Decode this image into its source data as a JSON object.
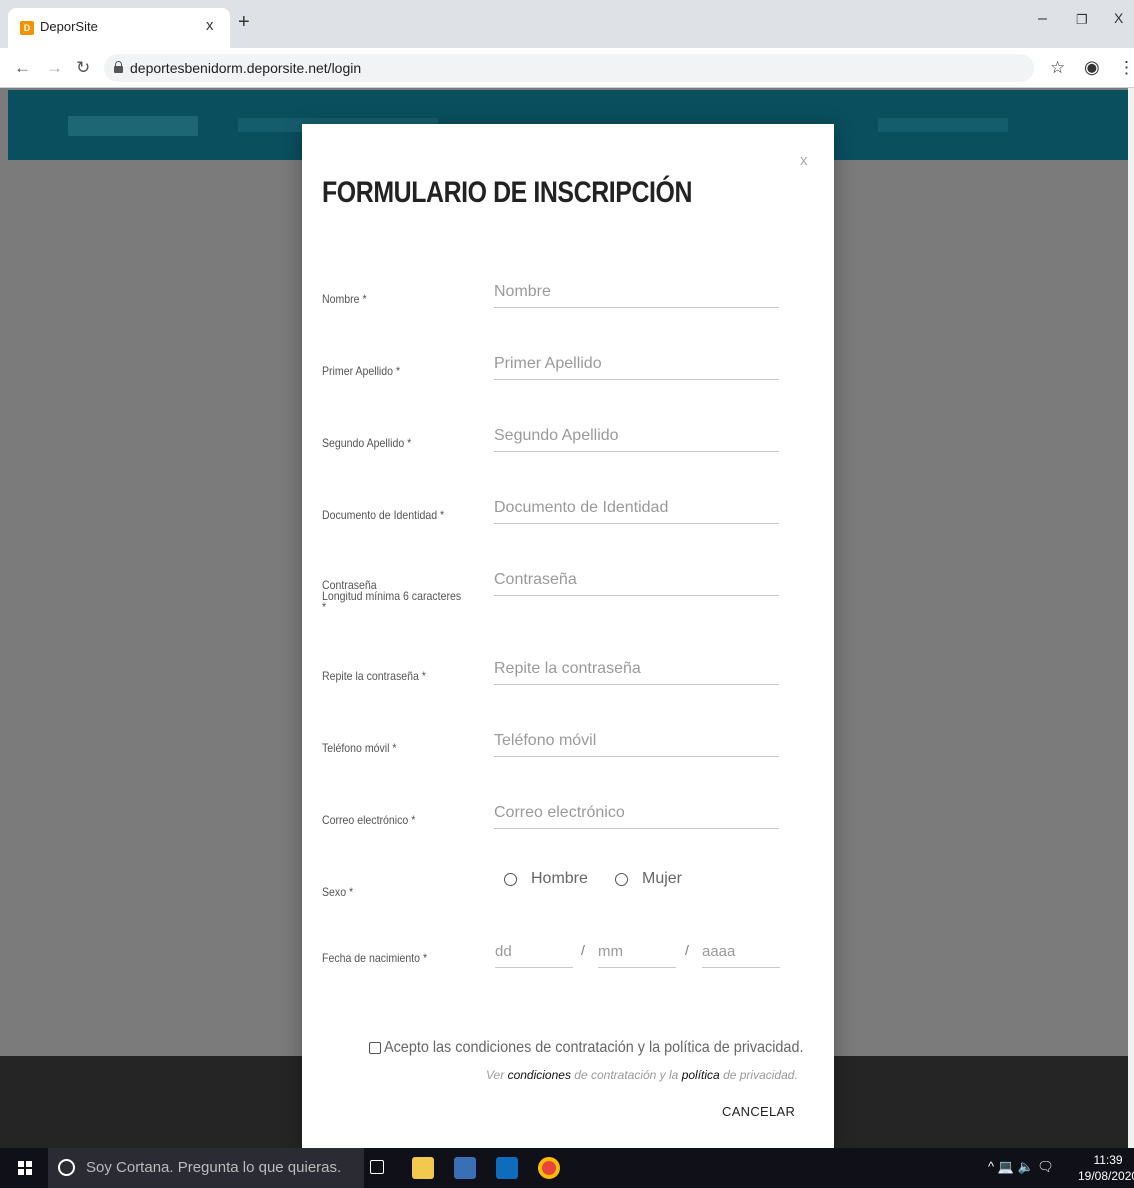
{
  "browser": {
    "tab_title": "DeporSite",
    "tab_favicon": "D",
    "tab_close": "x",
    "new_tab": "+",
    "url": "deportesbenidorm.deporsite.net/login",
    "window_controls": {
      "minimize": "–",
      "restore": "❐",
      "close": "X"
    }
  },
  "modal": {
    "close": "x",
    "title": "FORMULARIO DE INSCRIPCIÓN",
    "fields": {
      "nombre": {
        "label": "Nombre *",
        "placeholder": "Nombre"
      },
      "primer_apellido": {
        "label": "Primer Apellido *",
        "placeholder": "Primer Apellido"
      },
      "segundo_apellido": {
        "label": "Segundo Apellido *",
        "placeholder": "Segundo Apellido"
      },
      "documento": {
        "label": "Documento de Identidad *",
        "placeholder": "Documento de Identidad"
      },
      "contrasena": {
        "label_line1": "Contraseña",
        "label_line2": "Longitud mínima 6 caracteres",
        "label_line3": "*",
        "placeholder": "Contraseña"
      },
      "repite": {
        "label": "Repite la contraseña *",
        "placeholder": "Repite la contraseña"
      },
      "telefono": {
        "label": "Teléfono móvil *",
        "placeholder": "Teléfono móvil"
      },
      "correo": {
        "label": "Correo electrónico *",
        "placeholder": "Correo electrónico"
      },
      "sexo": {
        "label": "Sexo *",
        "options": [
          "Hombre",
          "Mujer"
        ]
      },
      "fecha": {
        "label": "Fecha de nacimiento *",
        "dd": "dd",
        "mm": "mm",
        "aaaa": "aaaa",
        "separator": "/"
      }
    },
    "accept_text": "Acepto las condiciones de contratación y la política de privacidad.",
    "terms": {
      "ver": "Ver",
      "condiciones": "condiciones",
      "de_contratacion": "de contratación y la",
      "politica": "política",
      "de_privacidad": "de privacidad."
    },
    "cancel": "CANCELAR"
  },
  "taskbar": {
    "cortana_text": "Soy Cortana. Pregunta lo que quieras.",
    "tray_icons": "^ 💻 🔈 🗨",
    "time": "11:39",
    "date": "19/08/2020"
  },
  "colors": {
    "site_header": "#0a4f5e",
    "overlay": "#7b7b7b",
    "favicon": "#f39200"
  }
}
